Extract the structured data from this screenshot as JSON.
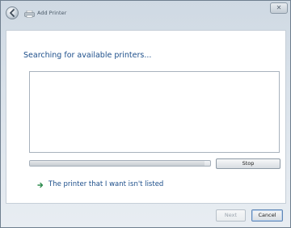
{
  "window": {
    "title": "Add Printer",
    "close_glyph": "✕"
  },
  "titlebar": {
    "back_icon": "back-arrow-icon",
    "app_icon": "printer-icon"
  },
  "main": {
    "heading": "Searching for available printers...",
    "progress_fraction": 0.97,
    "stop_label": "Stop",
    "option_link": "The printer that I want isn't listed",
    "option_icon": "right-arrow-icon"
  },
  "footer": {
    "next_label": "Next",
    "cancel_label": "Cancel"
  },
  "colors": {
    "link_blue": "#1c4e8a",
    "frame": "#cfd9e3"
  }
}
